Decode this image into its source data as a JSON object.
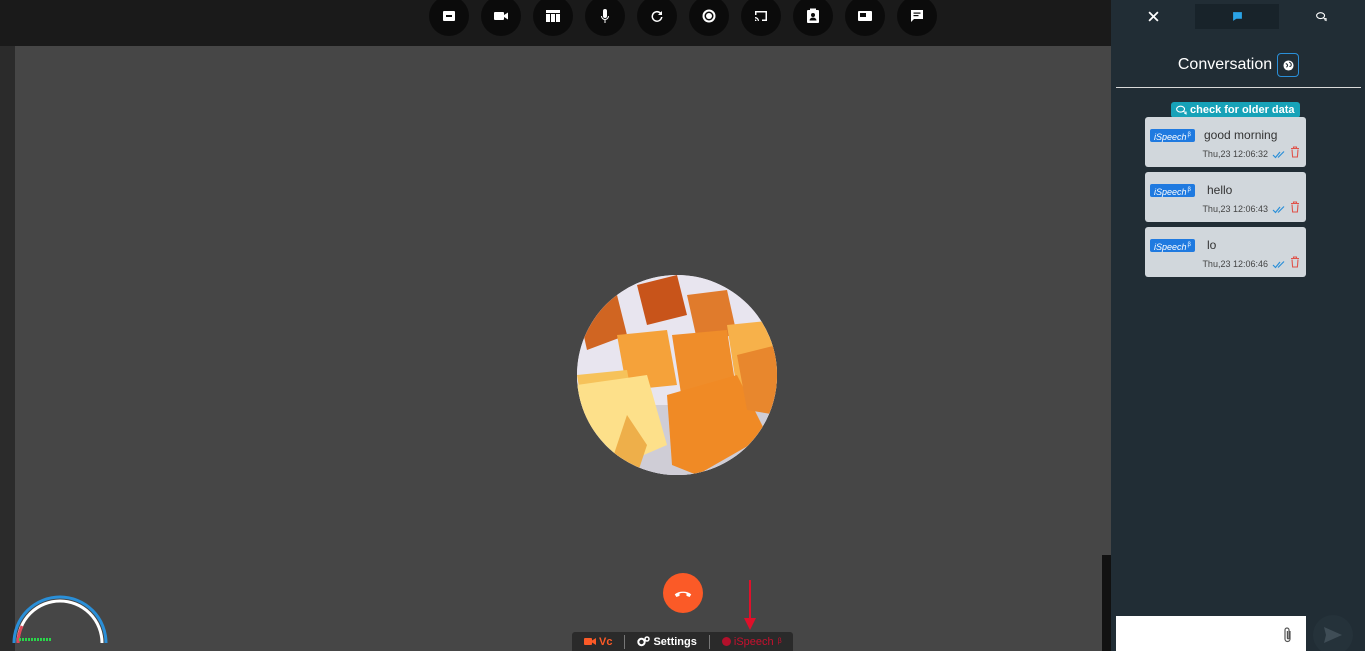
{
  "toolbar": {
    "buttons": [
      {
        "icon": "minimize-icon"
      },
      {
        "icon": "video-camera-icon"
      },
      {
        "icon": "layout-icon"
      },
      {
        "icon": "microphone-icon"
      },
      {
        "icon": "refresh-icon"
      },
      {
        "icon": "record-icon"
      },
      {
        "icon": "cast-icon"
      },
      {
        "icon": "contact-card-icon"
      },
      {
        "icon": "picture-in-picture-icon"
      },
      {
        "icon": "chat-icon"
      }
    ]
  },
  "call": {
    "hangup_icon": "hang-up-phone-icon"
  },
  "bottom_bar": {
    "vc_label": "Vc",
    "settings_label": "Settings",
    "ispeech_label": "iSpeech",
    "ispeech_sup": "β"
  },
  "panel": {
    "title": "Conversation",
    "older_button": "check for older data",
    "messages": [
      {
        "tag": "iSpeech",
        "tag_sup": "β",
        "text": "good morning",
        "time": "Thu,23 12:06:32"
      },
      {
        "tag": "iSpeech",
        "tag_sup": "β",
        "text": "hello",
        "time": "Thu,23 12:06:43"
      },
      {
        "tag": "iSpeech",
        "tag_sup": "β",
        "text": "lo",
        "time": "Thu,23 12:06:46"
      }
    ],
    "input_placeholder": ""
  },
  "colors": {
    "accent_orange": "#fb5a27",
    "ispeech_red": "#c8102e",
    "tag_blue": "#1f7ae0",
    "older_teal": "#17a2b8",
    "panel_bg": "#212d35",
    "stage_bg": "#464646"
  }
}
